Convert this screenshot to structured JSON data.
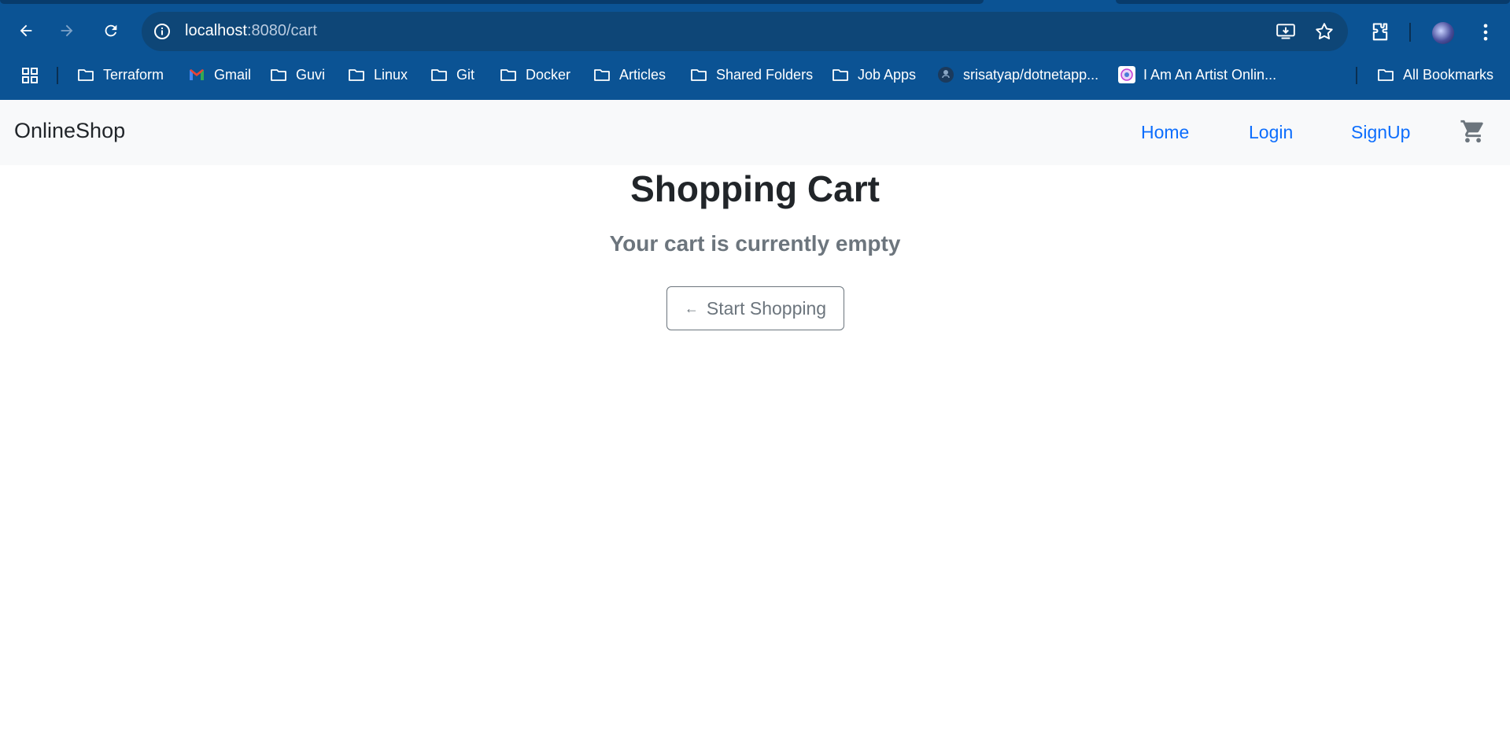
{
  "browser": {
    "url_host": "localhost",
    "url_path": ":8080/cart",
    "bookmarks": [
      {
        "label": "Terraform",
        "icon": "folder-icon"
      },
      {
        "label": "Gmail",
        "icon": "gmail-icon"
      },
      {
        "label": "Guvi",
        "icon": "folder-icon"
      },
      {
        "label": "Linux",
        "icon": "folder-icon"
      },
      {
        "label": "Git",
        "icon": "folder-icon"
      },
      {
        "label": "Docker",
        "icon": "folder-icon"
      },
      {
        "label": "Articles",
        "icon": "folder-icon"
      },
      {
        "label": "Shared Folders",
        "icon": "folder-icon"
      },
      {
        "label": "Job Apps",
        "icon": "folder-icon"
      },
      {
        "label": "srisatyap/dotnetapp...",
        "icon": "github-icon"
      },
      {
        "label": "I Am An Artist Onlin...",
        "icon": "site-favicon"
      },
      {
        "label": "All Bookmarks",
        "icon": "folder-icon"
      }
    ]
  },
  "navbar": {
    "brand": "OnlineShop",
    "links": [
      "Home",
      "Login",
      "SignUp"
    ],
    "cart_icon": "shopping-cart-icon"
  },
  "main": {
    "title": "Shopping Cart",
    "empty_message": "Your cart is currently empty",
    "start_button": {
      "arrow": "←",
      "label": "Start Shopping"
    }
  },
  "colors": {
    "chrome_bg": "#0b5394",
    "link": "#0d6efd",
    "muted": "#6c757d",
    "heading": "#212529"
  }
}
